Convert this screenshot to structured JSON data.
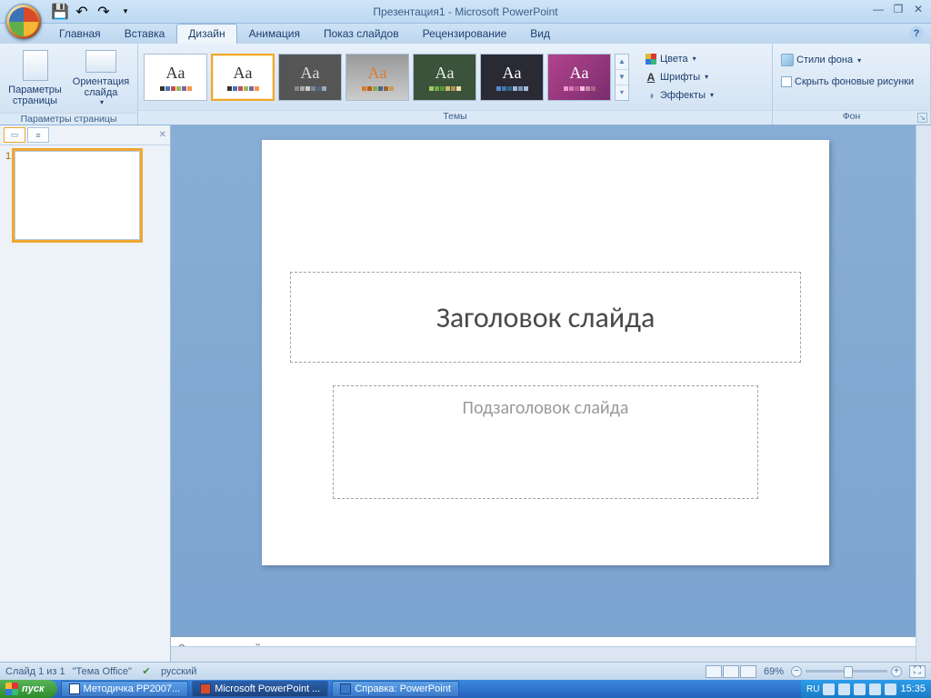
{
  "title": "Презентация1 - Microsoft PowerPoint",
  "tabs": [
    "Главная",
    "Вставка",
    "Дизайн",
    "Анимация",
    "Показ слайдов",
    "Рецензирование",
    "Вид"
  ],
  "active_tab": 2,
  "ribbon": {
    "group_page": {
      "btn_params": "Параметры страницы",
      "btn_orient": "Ориентация слайда",
      "label": "Параметры страницы"
    },
    "group_themes": {
      "label": "Темы",
      "colors": "Цвета",
      "fonts": "Шрифты",
      "effects": "Эффекты"
    },
    "group_bg": {
      "label": "Фон",
      "styles": "Стили фона",
      "hide": "Скрыть фоновые рисунки"
    }
  },
  "slide": {
    "title_ph": "Заголовок слайда",
    "sub_ph": "Подзаголовок слайда",
    "notes_ph": "Заметки к слайду",
    "thumb_num": "1"
  },
  "status": {
    "slide_info": "Слайд 1 из 1",
    "theme": "\"Тема Office\"",
    "lang": "русский",
    "zoom": "69%"
  },
  "taskbar": {
    "start": "пуск",
    "t1": "Методичка PP2007...",
    "t2": "Microsoft PowerPoint ...",
    "t3": "Справка: PowerPoint",
    "lang": "RU",
    "time": "15:35"
  }
}
